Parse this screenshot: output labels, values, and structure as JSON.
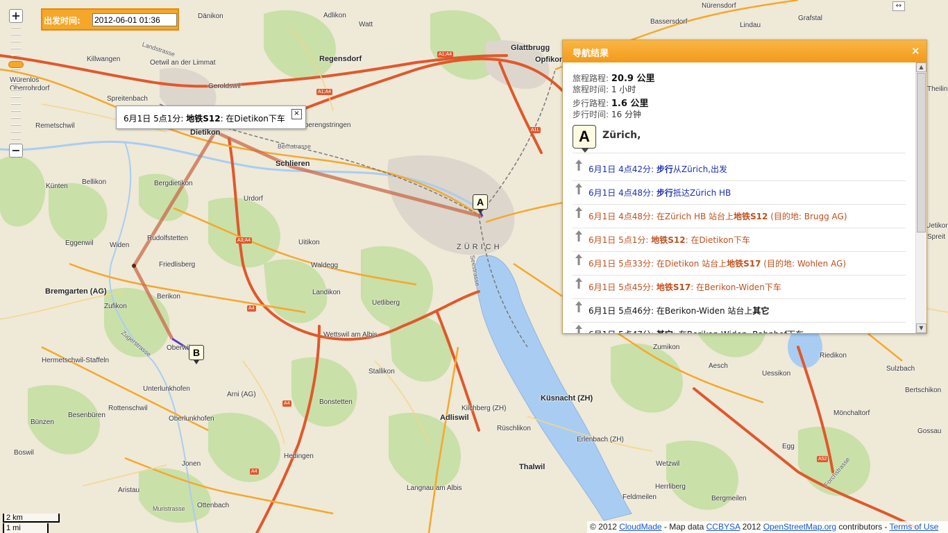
{
  "departure": {
    "label": "出发时间:",
    "value": "2012-06-01 01:36"
  },
  "zoom": {
    "plus": "+",
    "minus": "−"
  },
  "expand_icon": "↔",
  "popup": {
    "prefix": "6月1日 5点1分: ",
    "line": "地铁S12",
    "suffix": ": 在Dietikon下车",
    "close": "×"
  },
  "markers": {
    "a": "A",
    "b": "B"
  },
  "nav": {
    "title": "导航结果",
    "close": "×",
    "distance_label": "旅程路程: ",
    "distance_value": "20.9 公里",
    "time_label": "旅程时间: ",
    "time_value": "1 小时",
    "walk_distance_label": "步行路程: ",
    "walk_distance_value": "1.6 公里",
    "walk_time_label": "步行时间: ",
    "walk_time_value": "16 分钟",
    "start_marker": "A",
    "start_name": "Zürich,",
    "steps": [
      {
        "style": "blue",
        "pre": "6月1日 4点42分: ",
        "bold": "步行",
        "post": "从Zürich,出发"
      },
      {
        "style": "blue",
        "pre": "6月1日 4点48分: ",
        "bold": "步行",
        "post": "抵达Zürich HB"
      },
      {
        "style": "red",
        "pre": "6月1日 4点48分: 在Zürich HB 站台上",
        "bold": "地铁S12",
        "post": " (目的地: Brugg AG)"
      },
      {
        "style": "red",
        "pre": "6月1日 5点1分: ",
        "bold": "地铁S12",
        "post": ": 在Dietikon下车"
      },
      {
        "style": "red",
        "pre": "6月1日 5点33分: 在Dietikon 站台上",
        "bold": "地铁S17",
        "post": " (目的地: Wohlen AG)"
      },
      {
        "style": "red",
        "pre": "6月1日 5点45分: ",
        "bold": "地铁S17",
        "post": ": 在Berikon-Widen下车"
      },
      {
        "style": "black",
        "pre": "6月1日 5点46分: 在Berikon-Widen 站台上",
        "bold": "其它",
        "post": ""
      },
      {
        "style": "black",
        "pre": "6月1日 5点47分: ",
        "bold": "其它",
        "post": ": 在Berikon-Widen, Bahnhof下车"
      }
    ]
  },
  "scale": {
    "km": "2 km",
    "mi": "1 mi"
  },
  "attribution": {
    "pre": "© 2012 ",
    "cloudmade": "CloudMade",
    "mid1": " - Map data ",
    "ccbysa": "CCBYSA",
    "mid2": " 2012 ",
    "osm": "OpenStreetMap.org",
    "mid3": " contributors - ",
    "terms": "Terms of Use"
  },
  "places": [
    "Dänikon",
    "Adlikon",
    "Watt",
    "Nürensdorf",
    "Lindau",
    "Grafstal",
    "Bassersdorf",
    "Killwangen",
    "Oetwil an der Limmat",
    "Regensdorf",
    "Glattbrugg",
    "Opfikon",
    "Würenlos",
    "Oberrohrdorf",
    "Geroldswil",
    "Spreitenbach",
    "Theilingen",
    "Remetschwil",
    "Dietikon",
    "Bernstrasse",
    "Oberengstringen",
    "Schlieren",
    "Bellikon",
    "Künten",
    "Bergdietikon",
    "Urdorf",
    "Rudolfstetten",
    "Eggenwil",
    "Widen",
    "Friedlisberg",
    "Uitikon",
    "Waldegg",
    "Bremgarten (AG)",
    "Berikon",
    "Zufikon",
    "Landikon",
    "Uetliberg",
    "ZÜRICH",
    "Hermetschwil-Staffeln",
    "Oberwil",
    "Wettswil am Albis",
    "Stallikon",
    "Zumikon",
    "Aesch",
    "Uessikon",
    "Riedikon",
    "Sulzbach",
    "Bertschikon",
    "Unterlunkhofen",
    "Arni (AG)",
    "Bonstetten",
    "Küsnacht (ZH)",
    "Mönchaltorf",
    "Rottenschwil",
    "Besenbüren",
    "Oberlunkhofen",
    "Adliswil",
    "Kilchberg (ZH)",
    "Gossau",
    "Bünzen",
    "Rüschlikon",
    "Erlenbach (ZH)",
    "Egg",
    "Boswil",
    "Hedingen",
    "Jonen",
    "Thalwil",
    "Wetzwil",
    "Herrliberg",
    "Aristau",
    "Langnau am Albis",
    "Feldmeilen",
    "Bergmeilen",
    "Ottenbach",
    "Muristrasse",
    "Landstrasse",
    "Zugerstrasse",
    "Seestrasse",
    "Forchstrasse",
    "Uetikon",
    "Spreit"
  ],
  "road_shields": [
    "A1;A4",
    "A1;A4",
    "A1L",
    "A3;A4",
    "A4",
    "A4",
    "A4",
    "A52"
  ],
  "colors": {
    "land": "#efe9d8",
    "forest": "#c7dfa4",
    "water": "#a9cdf2",
    "motorway": "#e0582b",
    "primary": "#f6a72a",
    "route_rail": "#c86a4a",
    "route_walk": "#5b3cbf",
    "accent": "#f6a72a"
  }
}
